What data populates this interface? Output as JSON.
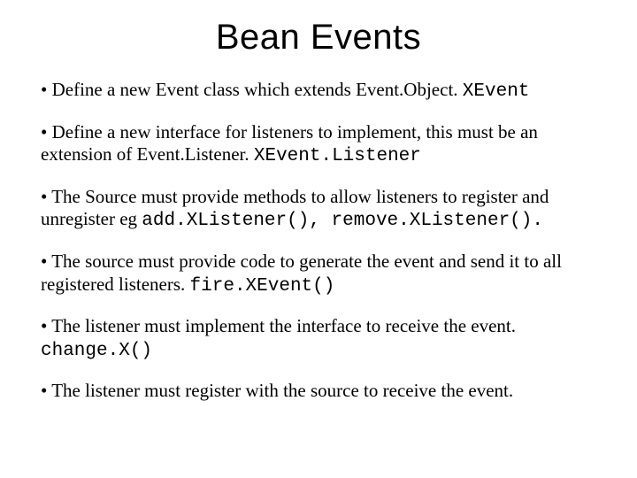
{
  "title": "Bean Events",
  "p1": {
    "lead": "• Define a new Event class which extends Event.Object. ",
    "code": "XEvent"
  },
  "p2": {
    "lead": "• Define a new interface for listeners to implement, this must be an extension of Event.Listener. ",
    "code": "XEvent.Listener"
  },
  "p3": {
    "lead": "• The Source must provide methods to allow listeners to register and unregister eg ",
    "code": "add.XListener(), remove.XListener()."
  },
  "p4": {
    "lead": "• The source must provide code to generate the event and send it to all registered listeners. ",
    "code": "fire.XEvent()"
  },
  "p5": {
    "lead": "• The listener must implement the interface to receive the event. ",
    "code": "change.X()"
  },
  "p6": {
    "lead": "• The listener must register with the source to receive the event."
  }
}
